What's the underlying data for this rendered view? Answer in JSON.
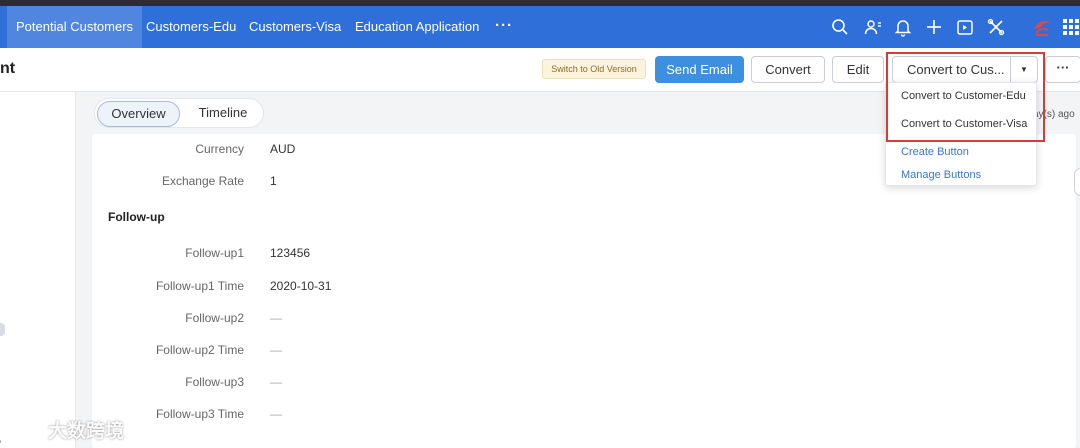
{
  "nav": {
    "tabs": [
      "Potential Customers",
      "Customers-Edu",
      "Customers-Visa",
      "Education Application"
    ],
    "more": "···"
  },
  "record": {
    "title_fragment": "nt"
  },
  "actions": {
    "old_version": "Switch to Old Version",
    "send_email": "Send Email",
    "convert": "Convert",
    "edit": "Edit",
    "convert_to_customer": "Convert to Cus...",
    "more": "···"
  },
  "dropdown": {
    "items": [
      "Convert to Customer-Edu",
      "Convert to Customer-Visa",
      "Create Button",
      "Manage Buttons"
    ]
  },
  "tabs": {
    "overview": "Overview",
    "timeline": "Timeline"
  },
  "time_ago": "ay(s) ago",
  "fields": {
    "currency": {
      "label": "Currency",
      "value": "AUD"
    },
    "exchange_rate": {
      "label": "Exchange Rate",
      "value": "1"
    }
  },
  "followup": {
    "section_title": "Follow-up",
    "rows": [
      {
        "label": "Follow-up1",
        "value": "123456"
      },
      {
        "label": "Follow-up1 Time",
        "value": "2020-10-31"
      },
      {
        "label": "Follow-up2",
        "value": "—"
      },
      {
        "label": "Follow-up2 Time",
        "value": "—"
      },
      {
        "label": "Follow-up3",
        "value": "—"
      },
      {
        "label": "Follow-up3 Time",
        "value": "—"
      }
    ]
  },
  "watermark": {
    "text": "大数跨境"
  },
  "colors": {
    "nav_bg": "#2f6fd9",
    "nav_active": "#5086e0",
    "primary_button": "#3d8fe0",
    "highlight": "#d83a3a",
    "link": "#3778c8"
  },
  "icons": [
    "search-icon",
    "contacts-icon",
    "bell-icon",
    "plus-icon",
    "calendar-icon",
    "tools-icon",
    "brand-logo",
    "apps-grid-icon"
  ]
}
